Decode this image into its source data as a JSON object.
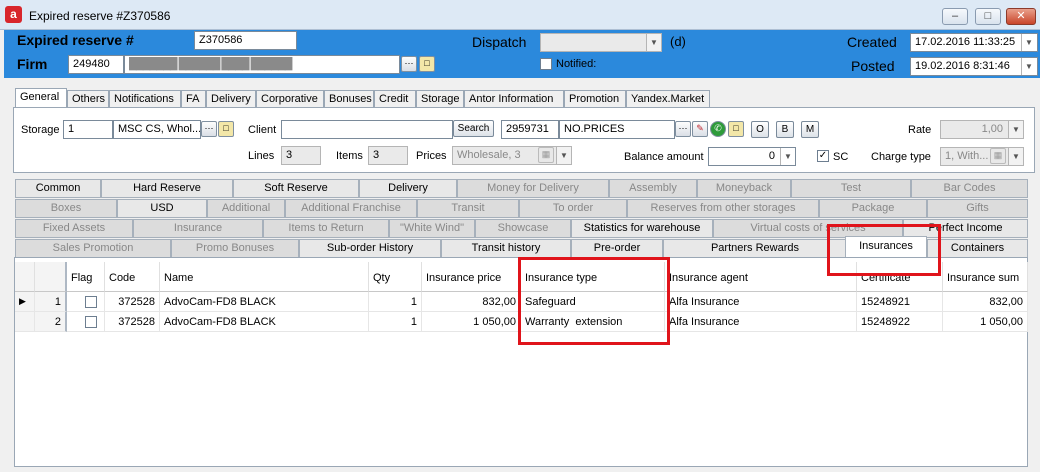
{
  "window": {
    "title": "Expired reserve #Z370586",
    "icon": "app-logo-icon"
  },
  "header": {
    "expired_label": "Expired reserve #",
    "expired_value": "Z370586",
    "firm_label": "Firm",
    "firm_code": "249480",
    "firm_name": "███████ ██████ ████ ██████",
    "dispatch_label": "Dispatch",
    "dispatch_suffix": "(d)",
    "notified_label": "Notified:",
    "created_label": "Created",
    "created_value": "17.02.2016 11:33:25",
    "posted_label": "Posted",
    "posted_value": "19.02.2016 8:31:46"
  },
  "top_tabs": [
    "General",
    "Others",
    "Notifications",
    "FA",
    "Delivery",
    "Corporative",
    "Bonuses",
    "Credit",
    "Storage",
    "Antor Information",
    "Promotion",
    "Yandex.Market"
  ],
  "general": {
    "storage_label": "Storage",
    "storage_code": "1",
    "storage_name": "MSC CS, Whol...",
    "client_label": "Client",
    "search_button": "Search",
    "price_code": "2959731",
    "price_name": "NO.PRICES",
    "btn_o": "O",
    "btn_b": "B",
    "btn_m": "M",
    "rate_label": "Rate",
    "rate_value": "1,00",
    "lines_label": "Lines",
    "lines_value": "3",
    "items_label": "Items",
    "items_value": "3",
    "prices_label": "Prices",
    "prices_value": "Wholesale, 3",
    "balance_label": "Balance amount",
    "balance_value": "0",
    "sc_label": "SC",
    "charge_label": "Charge type",
    "charge_value": "1, With..."
  },
  "grid_tabs": {
    "row1": [
      "Common",
      "Hard Reserve",
      "Soft Reserve",
      "Delivery",
      "Money for Delivery",
      "Assembly",
      "Moneyback",
      "Test",
      "Bar Codes"
    ],
    "row2": [
      "Boxes",
      "USD",
      "Additional",
      "Additional Franchise",
      "Transit",
      "To order",
      "Reserves from other storages",
      "Package",
      "Gifts"
    ],
    "row3": [
      "Fixed Assets",
      "Insurance",
      "Items to Return",
      "\"White Wind\"",
      "Showcase",
      "Statistics for warehouse",
      "Virtual costs of services",
      "Perfect Income"
    ],
    "row4": [
      "Sales Promotion",
      "Promo Bonuses",
      "Sub-order History",
      "Transit history",
      "Pre-order",
      "Partners Rewards",
      "Insurances",
      "Containers"
    ]
  },
  "table": {
    "columns": [
      "Flag",
      "Code",
      "Name",
      "Qty",
      "Insurance price",
      "Insurance type",
      "Insurance agent",
      "Certificate",
      "Insurance sum"
    ],
    "rows": [
      {
        "num": "1",
        "code": "372528",
        "name": "AdvoCam-FD8 BLACK",
        "qty": "1",
        "price": "832,00",
        "type": "Safeguard",
        "agent": "Alfa Insurance",
        "certificate": "15248921",
        "sum": "832,00"
      },
      {
        "num": "2",
        "code": "372528",
        "name": "AdvoCam-FD8 BLACK",
        "qty": "1",
        "price": "1 050,00",
        "type": "Warranty  extension",
        "agent": "Alfa Insurance",
        "certificate": "15248922",
        "sum": "1 050,00"
      }
    ]
  },
  "colors": {
    "header_blue": "#2b89dc",
    "highlight_red": "#e0141b"
  }
}
